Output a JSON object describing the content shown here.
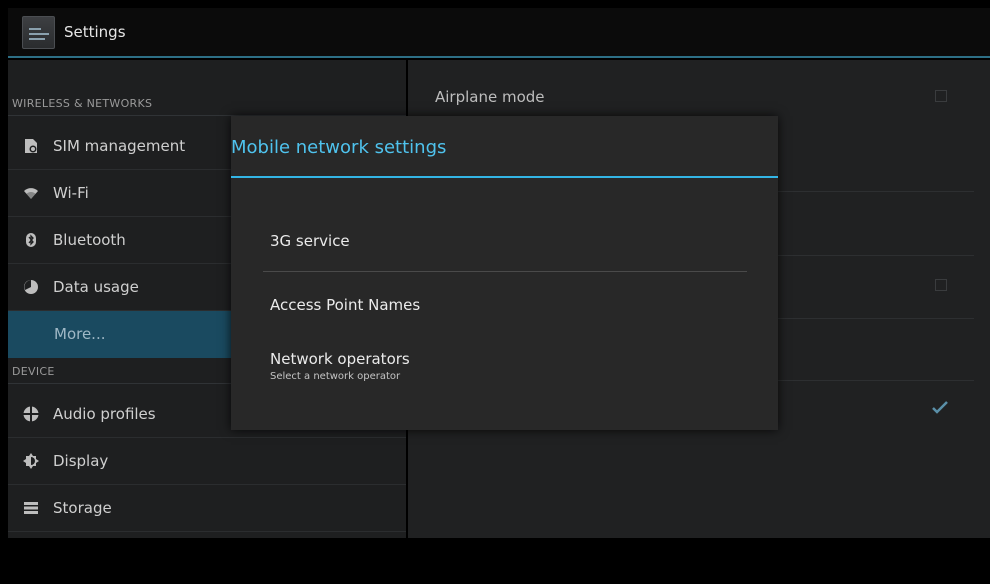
{
  "actionbar": {
    "title": "Settings",
    "icon": "settings-app-icon"
  },
  "sidebar": {
    "sections": [
      {
        "header": "WIRELESS & NETWORKS"
      },
      {
        "header": "DEVICE"
      }
    ],
    "items": [
      {
        "label": "SIM management",
        "icon": "sim-icon"
      },
      {
        "label": "Wi-Fi",
        "icon": "wifi-icon"
      },
      {
        "label": "Bluetooth",
        "icon": "bluetooth-icon"
      },
      {
        "label": "Data usage",
        "icon": "data-usage-icon"
      },
      {
        "label": "More...",
        "icon": "",
        "selected": true
      },
      {
        "label": "Audio profiles",
        "icon": "audio-profiles-icon"
      },
      {
        "label": "Display",
        "icon": "display-icon"
      },
      {
        "label": "Storage",
        "icon": "storage-icon"
      }
    ]
  },
  "main": {
    "airplane_mode_label": "Airplane mode",
    "checkbox_states": [
      false,
      false,
      true
    ]
  },
  "dialog": {
    "title": "Mobile network settings",
    "items": [
      {
        "title": "3G service",
        "summary": ""
      },
      {
        "title": "Access Point Names",
        "summary": ""
      },
      {
        "title": "Network operators",
        "summary": "Select a network operator"
      }
    ]
  },
  "colors": {
    "accent": "#33b5e5",
    "selected_bg": "#1a4a60",
    "dialog_bg": "#282828"
  }
}
